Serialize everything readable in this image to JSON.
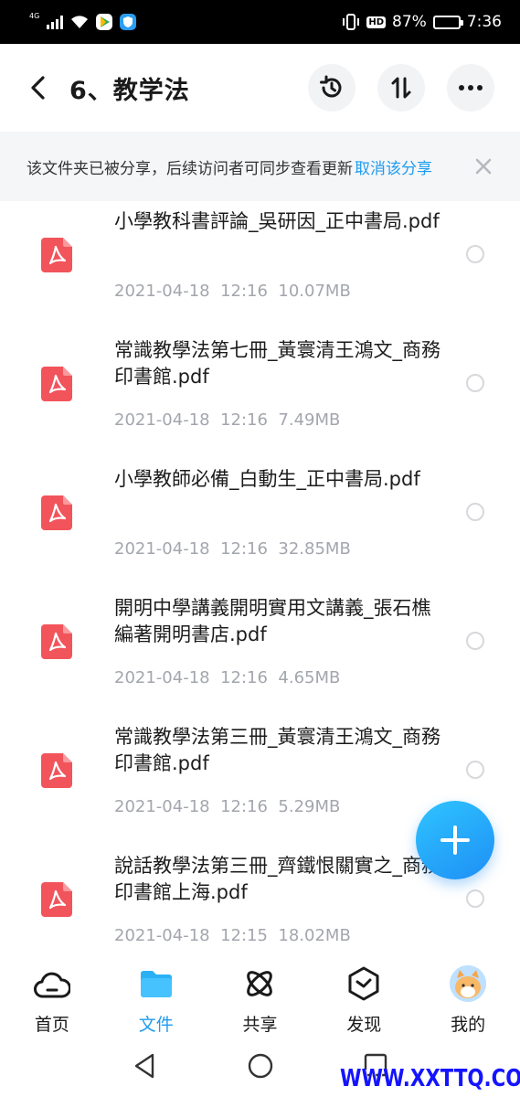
{
  "status_bar": {
    "network": "4G",
    "hd_label": "HD",
    "battery_percent": "87%",
    "battery_level": 0.87,
    "time": "7:36"
  },
  "header": {
    "title": "6、教学法",
    "icons": [
      "back-icon",
      "history-icon",
      "sort-icon",
      "more-icon"
    ]
  },
  "banner": {
    "text": "该文件夹已被分享，后续访问者可同步查看更新",
    "link": "取消该分享"
  },
  "files": [
    {
      "name": "小學教科書評論_吳研因_正中書局.pdf",
      "date": "2021-04-18",
      "time": "12:16",
      "size": "10.07MB"
    },
    {
      "name": "常識教學法第七冊_黃寰清王鴻文_商務印書館.pdf",
      "date": "2021-04-18",
      "time": "12:16",
      "size": "7.49MB"
    },
    {
      "name": "小學教師必備_白動生_正中書局.pdf",
      "date": "2021-04-18",
      "time": "12:16",
      "size": "32.85MB"
    },
    {
      "name": "開明中學講義開明實用文講義_張石樵編著開明書店.pdf",
      "date": "2021-04-18",
      "time": "12:16",
      "size": "4.65MB"
    },
    {
      "name": "常識教學法第三冊_黃寰清王鴻文_商務印書館.pdf",
      "date": "2021-04-18",
      "time": "12:16",
      "size": "5.29MB"
    },
    {
      "name": "說話教學法第三冊_齊鐵恨關實之_商務印書館上海.pdf",
      "date": "2021-04-18",
      "time": "12:15",
      "size": "18.02MB"
    }
  ],
  "tabs": [
    {
      "label": "首页",
      "icon": "cloud-home-icon"
    },
    {
      "label": "文件",
      "icon": "folder-icon"
    },
    {
      "label": "共享",
      "icon": "atom-share-icon"
    },
    {
      "label": "发现",
      "icon": "discover-hexagon-icon"
    },
    {
      "label": "我的",
      "icon": "avatar-icon"
    }
  ],
  "watermark": "WWW.XXTTQ.COM",
  "colors": {
    "accent": "#1e9cf0",
    "pdf_icon": "#f2545b",
    "meta_text": "#a3a6ad"
  }
}
